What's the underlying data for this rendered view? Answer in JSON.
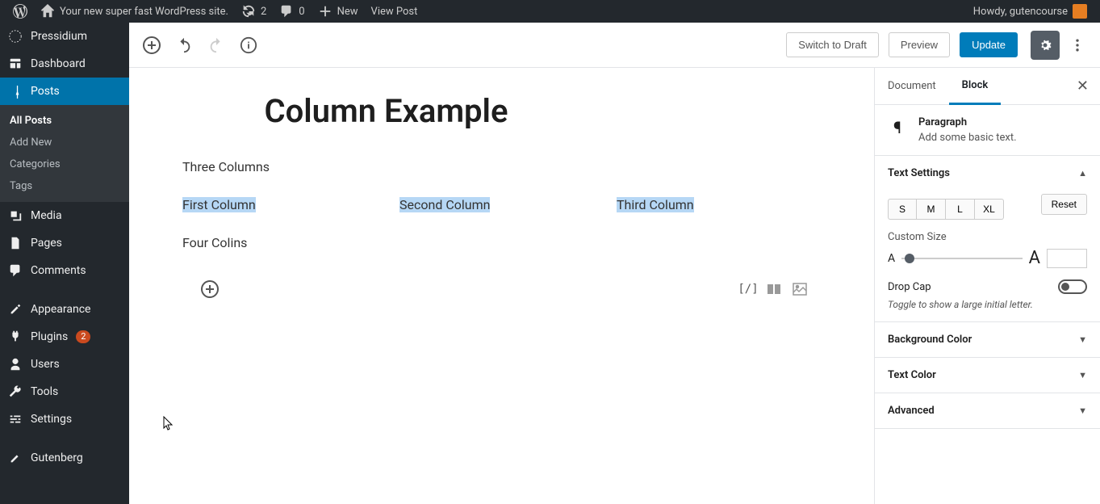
{
  "adminbar": {
    "site_name": "Your new super fast WordPress site.",
    "updates": "2",
    "comments": "0",
    "new_label": "New",
    "view_post": "View Post",
    "howdy": "Howdy, gutencourse"
  },
  "sidebar": {
    "items": [
      {
        "label": "Pressidium",
        "icon": "pressidium"
      },
      {
        "label": "Dashboard",
        "icon": "dashboard"
      },
      {
        "label": "Posts",
        "icon": "pin",
        "active": true
      },
      {
        "label": "Media",
        "icon": "media"
      },
      {
        "label": "Pages",
        "icon": "page"
      },
      {
        "label": "Comments",
        "icon": "comment"
      },
      {
        "label": "Appearance",
        "icon": "appearance"
      },
      {
        "label": "Plugins",
        "icon": "plugin",
        "badge": "2"
      },
      {
        "label": "Users",
        "icon": "user"
      },
      {
        "label": "Tools",
        "icon": "tool"
      },
      {
        "label": "Settings",
        "icon": "settings"
      },
      {
        "label": "Gutenberg",
        "icon": "gutenberg"
      }
    ],
    "posts_submenu": [
      "All Posts",
      "Add New",
      "Categories",
      "Tags"
    ]
  },
  "editor": {
    "switch_draft": "Switch to Draft",
    "preview": "Preview",
    "update": "Update",
    "post_title": "Column Example",
    "para_three": "Three Columns",
    "columns_three": [
      "First Column",
      "Second Column",
      "Third Column"
    ],
    "para_four": "Four Colins"
  },
  "panel": {
    "tab_document": "Document",
    "tab_block": "Block",
    "block_name": "Paragraph",
    "block_desc": "Add some basic text.",
    "text_settings": "Text Settings",
    "sizes": [
      "S",
      "M",
      "L",
      "XL"
    ],
    "reset": "Reset",
    "custom_size": "Custom Size",
    "drop_cap": "Drop Cap",
    "drop_cap_help": "Toggle to show a large initial letter.",
    "bg_color": "Background Color",
    "text_color": "Text Color",
    "advanced": "Advanced"
  }
}
